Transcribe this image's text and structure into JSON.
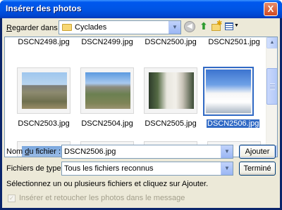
{
  "window": {
    "title": "Insérer des photos",
    "close_glyph": "X"
  },
  "toolbar": {
    "lookin_label_pre": "R",
    "lookin_label_rest": "egarder dans :",
    "lookin_value": "Cyclades",
    "lookin_arrow": "▼",
    "back_glyph": "◀",
    "up_glyph": "⬆",
    "newfolder_glyph": "✱",
    "views_arrow": "▼"
  },
  "files": {
    "row1": [
      "DSCN2498.jpg",
      "DSCN2499.jpg",
      "DSCN2500.jpg",
      "DSCN2501.jpg"
    ],
    "row2": [
      "DSCN2503.jpg",
      "DSCN2504.jpg",
      "DSCN2505.jpg",
      "DSCN2506.jpg"
    ],
    "selected": "DSCN2506.jpg",
    "scroll_up": "▲",
    "scroll_down": "▼"
  },
  "form": {
    "filename_label_pre": "Nom ",
    "filename_label_u": "d",
    "filename_label_rest": "u fichier :",
    "filename_value": "DSCN2506.jpg",
    "filetype_label_pre": "Fichiers de ",
    "filetype_label_u": "t",
    "filetype_label_rest": "ype :",
    "filetype_value": "Tous les fichiers reconnus",
    "combo_arrow": "▼",
    "add_button": "Ajouter",
    "done_button": "Terminé"
  },
  "hint_text": "Sélectionnez un ou plusieurs fichiers et cliquez sur Ajouter.",
  "option": {
    "label": "Insérer et retoucher les photos dans le message",
    "checked": true,
    "check_glyph": "✓"
  }
}
